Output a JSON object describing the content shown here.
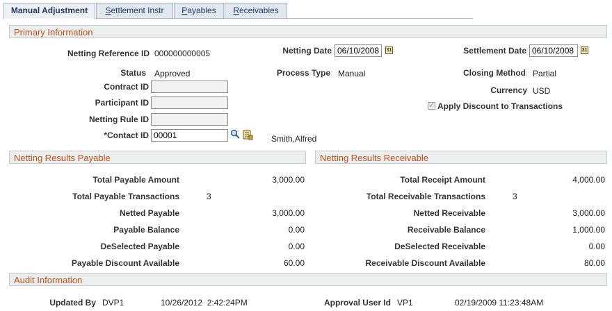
{
  "tabs": [
    {
      "label": "Manual Adjustment",
      "hotkey_prefix": "",
      "hotkey": "",
      "hotkey_rest": ""
    },
    {
      "label_pre": "",
      "hotkey": "S",
      "label_rest": "ettlement Instr"
    },
    {
      "label_pre": "",
      "hotkey": "P",
      "label_rest": "ayables"
    },
    {
      "label_pre": "",
      "hotkey": "R",
      "label_rest": "eceivables"
    }
  ],
  "primary": {
    "section_title": "Primary Information",
    "netting_ref_label": "Netting Reference ID",
    "netting_ref_value": "000000000005",
    "netting_date_label": "Netting Date",
    "netting_date_value": "06/10/2008",
    "settlement_date_label": "Settlement Date",
    "settlement_date_value": "06/10/2008",
    "status_label": "Status",
    "status_value": "Approved",
    "process_type_label": "Process Type",
    "process_type_value": "Manual",
    "closing_method_label": "Closing Method",
    "closing_method_value": "Partial",
    "contract_id_label": "Contract ID",
    "contract_id_value": "",
    "currency_label": "Currency",
    "currency_value": "USD",
    "participant_id_label": "Participant ID",
    "participant_id_value": "",
    "apply_discount_label": "Apply Discount to Transactions",
    "apply_discount_checked": true,
    "netting_rule_label": "Netting Rule ID",
    "netting_rule_value": "",
    "contact_id_label": "*Contact ID",
    "contact_id_value": "00001",
    "contact_name": "Smith,Alfred"
  },
  "payable": {
    "section_title": "Netting Results Payable",
    "rows": [
      {
        "label": "Total Payable Amount",
        "value": "3,000.00"
      },
      {
        "label": "Total Payable Transactions",
        "count": "3"
      },
      {
        "label": "Netted Payable",
        "value": "3,000.00"
      },
      {
        "label": "Payable Balance",
        "value": "0.00"
      },
      {
        "label": "DeSelected Payable",
        "value": "0.00"
      },
      {
        "label": "Payable Discount Available",
        "value": "60.00"
      }
    ]
  },
  "receivable": {
    "section_title": "Netting Results Receivable",
    "rows": [
      {
        "label": "Total Receipt Amount",
        "value": "4,000.00"
      },
      {
        "label": "Total Receivable Transactions",
        "count": "3"
      },
      {
        "label": "Netted Receivable",
        "value": "3,000.00"
      },
      {
        "label": "Receivable Balance",
        "value": "1,000.00"
      },
      {
        "label": "DeSelected Receivable",
        "value": "0.00"
      },
      {
        "label": "Receivable Discount Available",
        "value": "80.00"
      }
    ]
  },
  "audit": {
    "section_title": "Audit Information",
    "updated_by_label": "Updated By",
    "updated_by_value": "DVP1",
    "updated_at": "10/26/2012  2:42:24PM",
    "approval_label": "Approval User Id",
    "approval_value": "VP1",
    "approval_at": "02/19/2009 11:23:48AM"
  },
  "icons": {
    "calendar": "calendar-icon",
    "lookup": "search-icon",
    "detail": "detail-page-icon"
  },
  "colors": {
    "section_title": "#b6531b",
    "tab_text": "#1a3a6e",
    "section_bg": "#eceded"
  }
}
